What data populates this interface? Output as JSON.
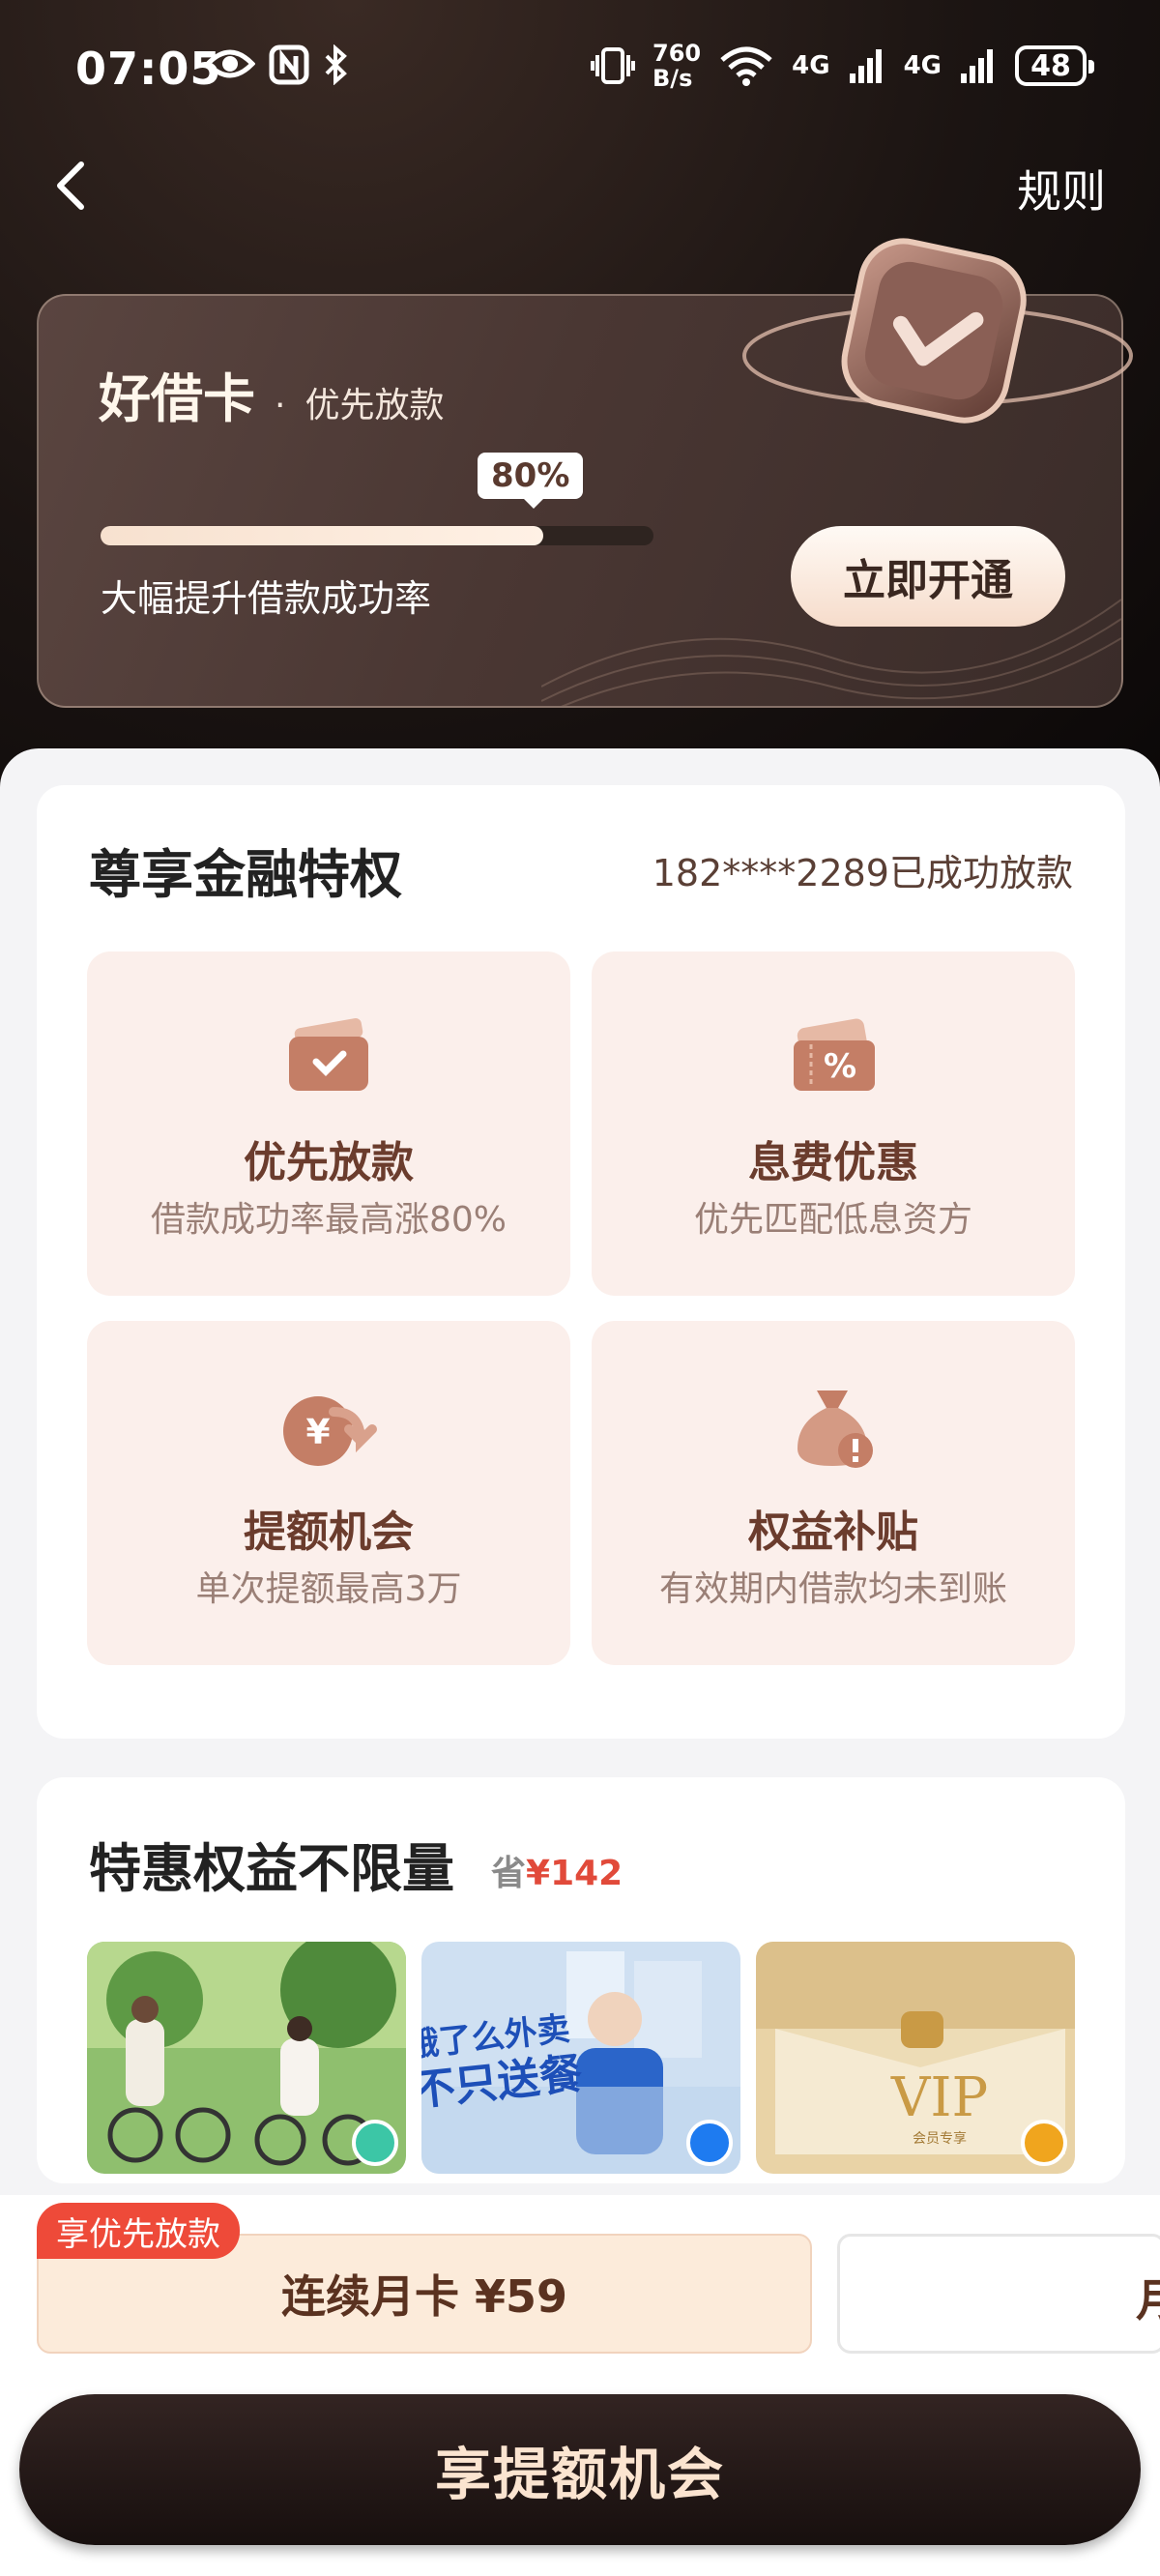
{
  "status_bar": {
    "time": "07:05",
    "speed_top": "760",
    "speed_bottom": "B/s",
    "net1": "4G",
    "net2": "4G",
    "battery": "48"
  },
  "header": {
    "rules_label": "规则"
  },
  "vip_card": {
    "title": "好借卡",
    "dot": "·",
    "subtitle": "优先放款",
    "progress_label": "80%",
    "progress": 0.8,
    "description": "大幅提升借款成功率",
    "open_button": "立即开通"
  },
  "privileges": {
    "title": "尊享金融特权",
    "note": "182****2289已成功放款",
    "items": [
      {
        "title": "优先放款",
        "desc": "借款成功率最高涨80%",
        "icon": "wallet-check-icon"
      },
      {
        "title": "息费优惠",
        "desc": "优先匹配低息资方",
        "icon": "coupon-percent-icon"
      },
      {
        "title": "提额机会",
        "desc": "单次提额最高3万",
        "icon": "yuan-up-icon"
      },
      {
        "title": "权益补贴",
        "desc": "有效期内借款均未到账",
        "icon": "money-bag-alert-icon"
      }
    ]
  },
  "benefits": {
    "title": "特惠权益不限量",
    "save_label": "省",
    "save_value": "¥142",
    "images": [
      {
        "text": "",
        "logo_color": "#3cc6a6"
      },
      {
        "text_line1": "饿了么外卖",
        "text_line2": "不只送餐",
        "logo_color": "#1e7bf0"
      },
      {
        "text": "VIP",
        "small": "会员专享",
        "logo_color": "#f0a51e"
      }
    ]
  },
  "plans": {
    "promo_tag": "享优先放款",
    "plan1": "连续月卡 ¥59",
    "plan2_partial": "月"
  },
  "cta": {
    "label": "享提额机会"
  },
  "colors": {
    "accent": "#6b3c2d",
    "promo_red": "#ee4a39",
    "tile_bg": "#fbefeb"
  }
}
